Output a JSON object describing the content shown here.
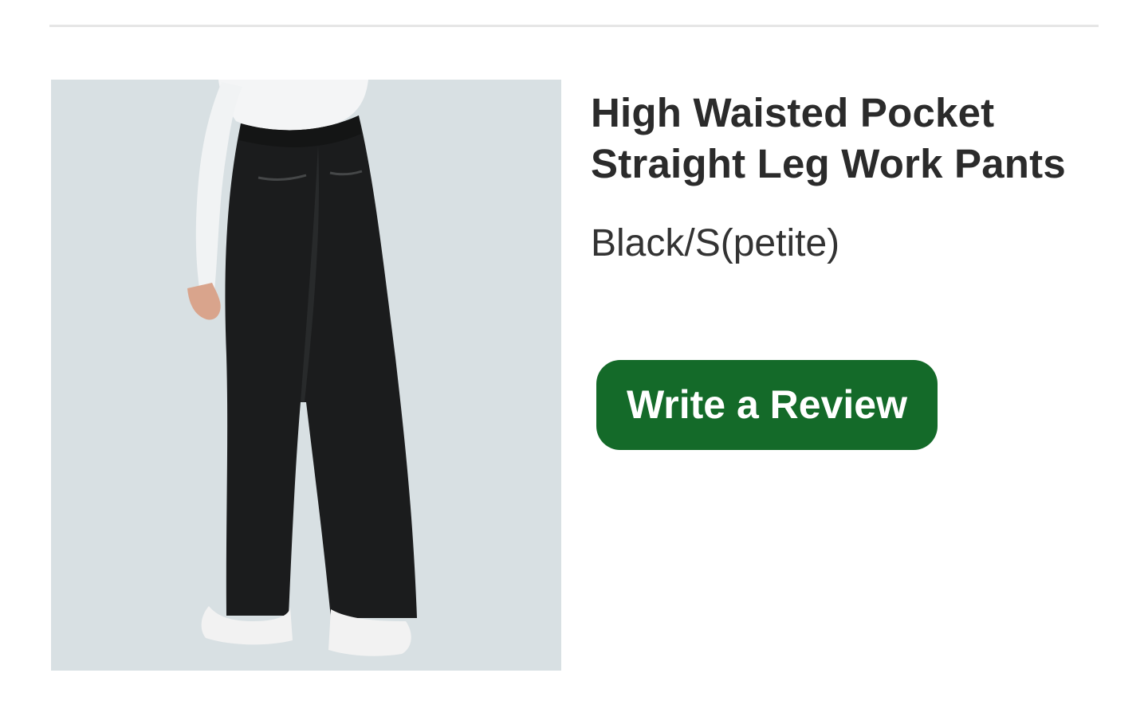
{
  "product": {
    "title": "High Waisted Pocket Straight Leg Work Pants",
    "variant": "Black/S(petite)",
    "image_icon": "product-photo-black-wide-leg-pants"
  },
  "actions": {
    "review_label": "Write a Review"
  },
  "colors": {
    "accent": "#146a29",
    "divider": "#e6e6e6",
    "image_background": "#d8e0e3",
    "text_primary": "#2b2b2b"
  }
}
